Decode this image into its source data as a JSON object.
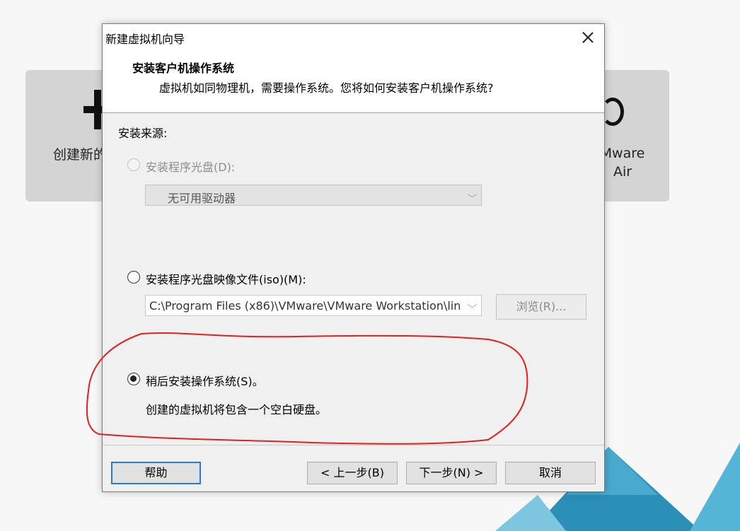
{
  "background": {
    "left_card_label": "创建新的",
    "right_card_label": "Mware\nAir"
  },
  "dialog": {
    "title": "新建虚拟机向导",
    "header_title": "安装客户机操作系统",
    "header_subtitle": "虚拟机如同物理机，需要操作系统。您将如何安装客户机操作系统?",
    "source_label": "安装来源:",
    "option_disc": {
      "label": "安装程序光盘(D):",
      "checked": false,
      "enabled": false,
      "drive_value": "无可用驱动器"
    },
    "option_iso": {
      "label": "安装程序光盘映像文件(iso)(M):",
      "checked": false,
      "enabled": true,
      "path_value": "C:\\Program Files (x86)\\VMware\\VMware Workstation\\lin",
      "browse_label": "浏览(R)..."
    },
    "option_later": {
      "label": "稍后安装操作系统(S)。",
      "checked": true,
      "enabled": true,
      "description": "创建的虚拟机将包含一个空白硬盘。"
    },
    "buttons": {
      "help": "帮助",
      "back": "< 上一步(B)",
      "next": "下一步(N) >",
      "cancel": "取消"
    }
  },
  "colors": {
    "annotation": "#e02020",
    "focus": "#2a7ad5",
    "vmware_teal": "#3fa3c8"
  }
}
